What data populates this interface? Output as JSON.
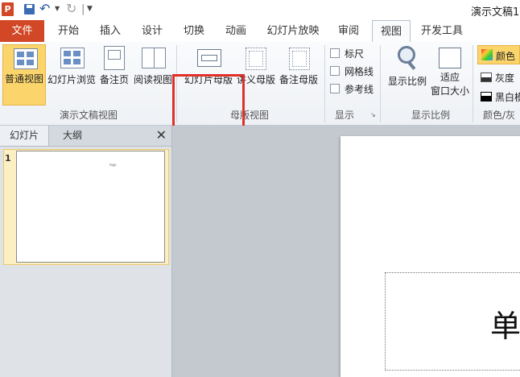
{
  "window": {
    "title": "演示文稿1"
  },
  "qat": {
    "app_icon": "P"
  },
  "tabs": [
    {
      "label": "文件"
    },
    {
      "label": "开始"
    },
    {
      "label": "插入"
    },
    {
      "label": "设计"
    },
    {
      "label": "切换"
    },
    {
      "label": "动画"
    },
    {
      "label": "幻灯片放映"
    },
    {
      "label": "审阅"
    },
    {
      "label": "视图"
    },
    {
      "label": "开发工具"
    }
  ],
  "ribbon": {
    "presentation_views": {
      "label": "演示文稿视图",
      "normal": "普通视图",
      "sorter": "幻灯片浏览",
      "notes": "备注页",
      "reading": "阅读视图"
    },
    "master_views": {
      "label": "母版视图",
      "slide_master": "幻灯片母版",
      "handout_master": "讲义母版",
      "notes_master": "备注母版"
    },
    "show": {
      "label": "显示",
      "ruler": "标尺",
      "gridlines": "网格线",
      "guides": "参考线"
    },
    "zoom": {
      "label": "显示比例",
      "zoom": "显示比例",
      "fit_line1": "适应",
      "fit_line2": "窗口大小"
    },
    "color": {
      "label": "颜色/灰",
      "color": "颜色",
      "grayscale": "灰度",
      "bw": "黑白模"
    }
  },
  "left_pane": {
    "tabs": [
      "幻灯片",
      "大纲"
    ],
    "slides": [
      {
        "number": "1",
        "text": "logo"
      }
    ]
  },
  "slide": {
    "text": "单"
  },
  "colors": {
    "file_tab": "#d24726",
    "highlight": "#e0302a",
    "selected_btn": "#fbd56b"
  }
}
